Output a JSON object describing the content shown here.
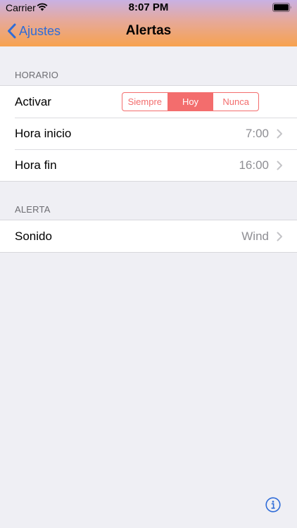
{
  "status": {
    "carrier": "Carrier",
    "time": "8:07 PM"
  },
  "nav": {
    "back_label": "Ajustes",
    "title": "Alertas"
  },
  "schedule": {
    "header": "HORARIO",
    "activate_label": "Activar",
    "segments": [
      "Siempre",
      "Hoy",
      "Nunca"
    ],
    "selected_segment": "Hoy",
    "start_label": "Hora inicio",
    "start_value": "7:00",
    "end_label": "Hora fin",
    "end_value": "16:00"
  },
  "alert": {
    "header": "ALERTA",
    "sound_label": "Sonido",
    "sound_value": "Wind"
  },
  "colors": {
    "tint": "#2f6cd8",
    "segment_accent": "#f36d6d",
    "header_gradient_top": "#c8b1e3",
    "header_gradient_bottom": "#f7a24e"
  },
  "icons": [
    "wifi-icon",
    "battery-icon",
    "chevron-left-icon",
    "chevron-right-icon",
    "info-icon"
  ]
}
